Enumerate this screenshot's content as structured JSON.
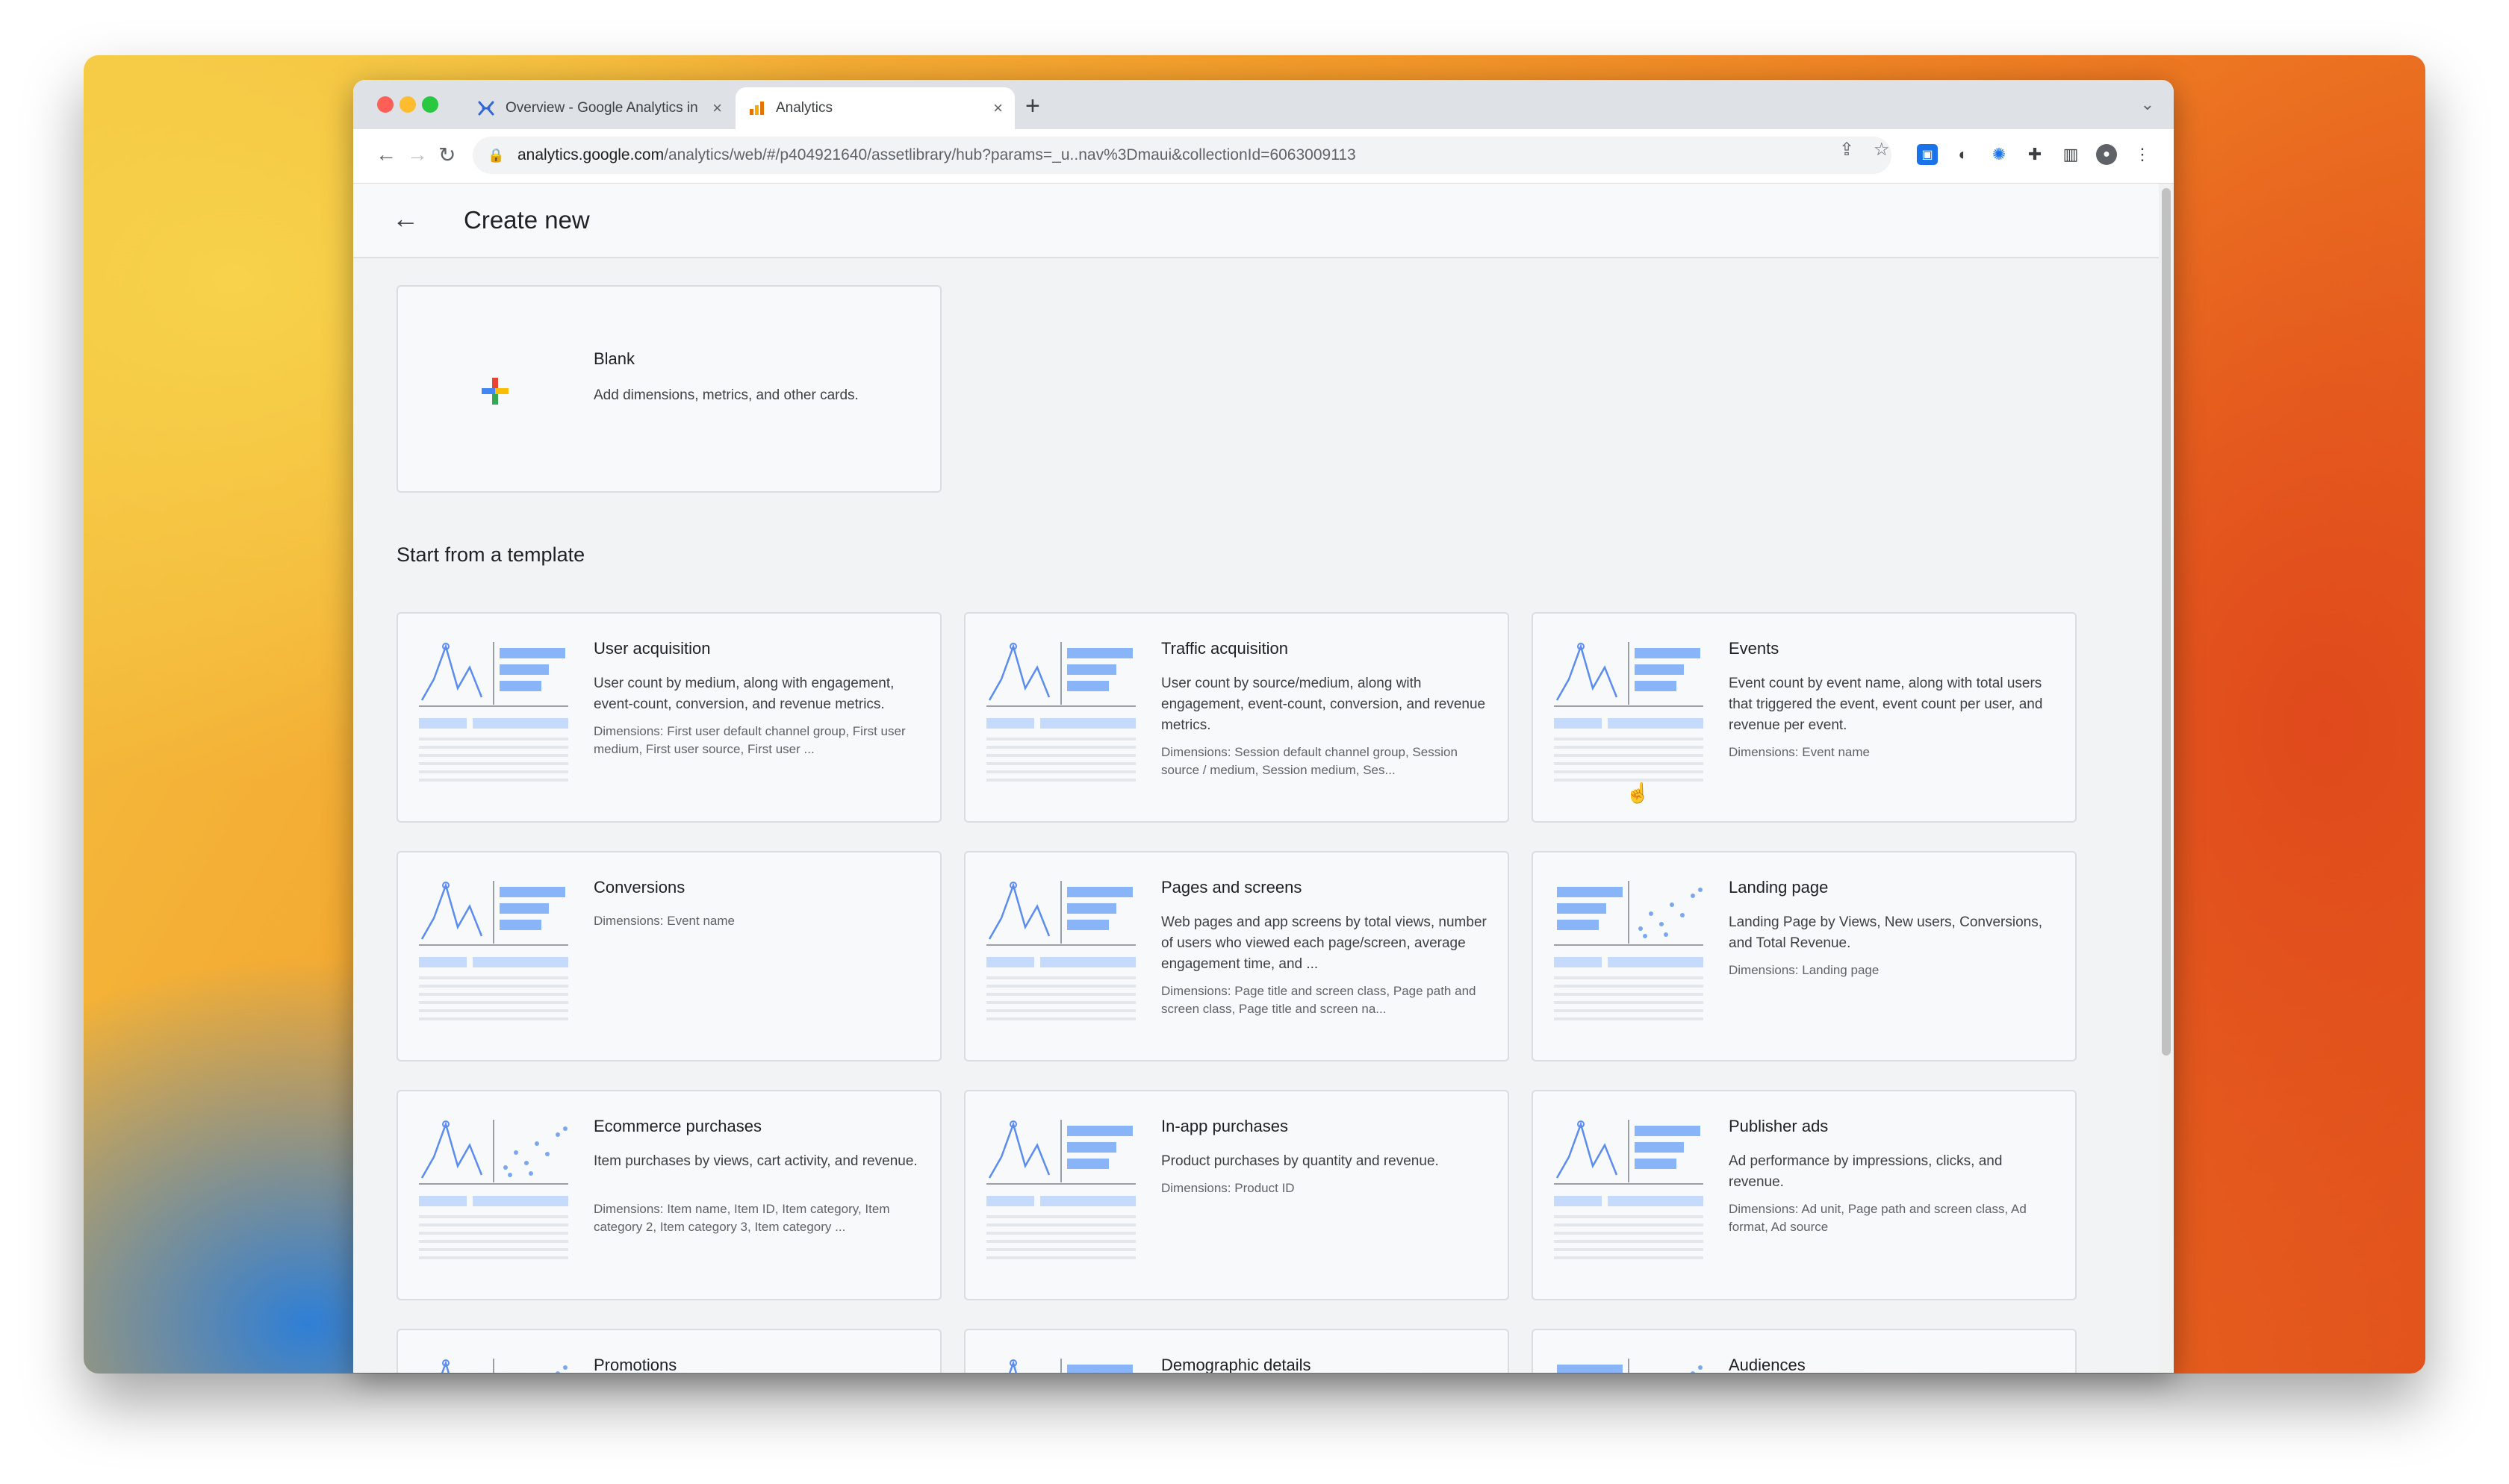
{
  "browser": {
    "tabs": [
      {
        "title": "Overview - Google Analytics in",
        "active": false
      },
      {
        "title": "Analytics",
        "active": true
      }
    ],
    "url_host": "analytics.google.com",
    "url_path": "/analytics/web/#/p404921640/assetlibrary/hub?params=_u..nav%3Dmaui&collectionId=6063009113"
  },
  "page": {
    "title": "Create new",
    "blank": {
      "title": "Blank",
      "description": "Add dimensions, metrics, and other cards."
    },
    "section_title": "Start from a template",
    "templates": [
      {
        "title": "User acquisition",
        "description": "User count by medium, along with engagement, event-count, conversion, and revenue metrics.",
        "dimensions": "Dimensions: First user default channel group, First user medium, First user source, First user ...",
        "thumb": "lines-bars"
      },
      {
        "title": "Traffic acquisition",
        "description": "User count by source/medium, along with engagement, event-count, conversion, and revenue metrics.",
        "dimensions": "Dimensions: Session default channel group, Session source / medium, Session medium, Ses...",
        "thumb": "lines-bars"
      },
      {
        "title": "Events",
        "description": "Event count by event name, along with total users that triggered the event, event count per user, and revenue per event.",
        "dimensions": "Dimensions: Event name",
        "thumb": "lines-bars"
      },
      {
        "title": "Conversions",
        "description": "",
        "dimensions": "Dimensions: Event name",
        "thumb": "lines-bars"
      },
      {
        "title": "Pages and screens",
        "description": "Web pages and app screens by total views, number of users who viewed each page/screen, average engagement time, and ...",
        "dimensions": "Dimensions: Page title and screen class, Page path and screen class, Page title and screen na...",
        "thumb": "lines-bars"
      },
      {
        "title": "Landing page",
        "description": "Landing Page by Views, New users, Conversions, and Total Revenue.",
        "dimensions": "Dimensions: Landing page",
        "thumb": "bars-dots"
      },
      {
        "title": "Ecommerce purchases",
        "description": "Item purchases by views, cart activity, and revenue.",
        "dimensions": "Dimensions: Item name, Item ID, Item category, Item category 2, Item category 3, Item category ...",
        "thumb": "lines-dots"
      },
      {
        "title": "In-app purchases",
        "description": "Product purchases by quantity and revenue.",
        "dimensions": "Dimensions: Product ID",
        "thumb": "lines-bars"
      },
      {
        "title": "Publisher ads",
        "description": "Ad performance by impressions, clicks, and revenue.",
        "dimensions": "Dimensions: Ad unit, Page path and screen class, Ad format, Ad source",
        "thumb": "lines-bars"
      },
      {
        "title": "Promotions",
        "description": "",
        "dimensions": "",
        "thumb": "lines-dots"
      },
      {
        "title": "Demographic details",
        "description": "",
        "dimensions": "",
        "thumb": "lines-bars"
      },
      {
        "title": "Audiences",
        "description": "",
        "dimensions": "",
        "thumb": "bars-dots"
      }
    ]
  }
}
